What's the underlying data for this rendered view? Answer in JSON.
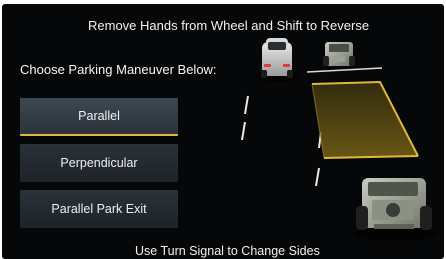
{
  "header": {
    "title": "Remove Hands from Wheel and Shift to Reverse",
    "subtitle": "Choose Parking Maneuver Below:"
  },
  "menu": {
    "items": [
      {
        "label": "Parallel",
        "selected": true
      },
      {
        "label": "Perpendicular",
        "selected": false
      },
      {
        "label": "Parallel Park Exit",
        "selected": false
      }
    ]
  },
  "footer": {
    "hint": "Use Turn Signal to Change Sides"
  },
  "colors": {
    "background": "#060708",
    "accent": "#e0b83a",
    "parking_zone": "#6b5a14",
    "button": "#1f262c",
    "text": "#f2f2f2"
  },
  "icons": [
    "own-vehicle-icon",
    "parked-jeep-icon"
  ]
}
